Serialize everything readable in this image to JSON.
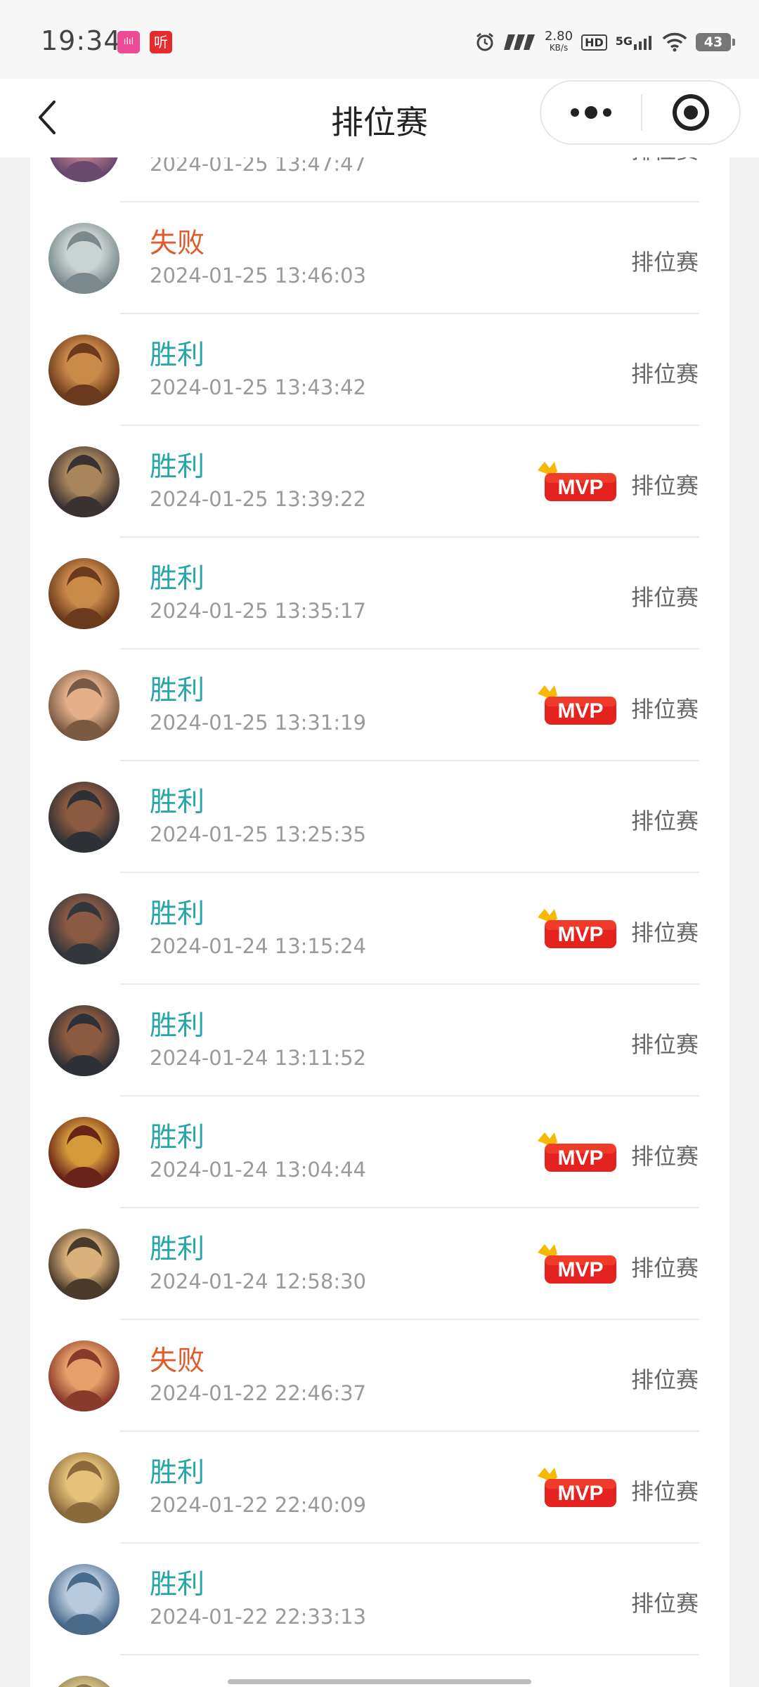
{
  "status_bar": {
    "time": "19:34",
    "app_icon_1": "bilibili-icon",
    "app_icon_2_label": "听",
    "speed_value": "2.80",
    "speed_unit": "KB/s",
    "hd_label": "HD",
    "network_label": "5G",
    "battery_level": "43"
  },
  "nav": {
    "title": "排位赛",
    "back_icon": "back-chevron-icon",
    "more_icon": "more-dots-icon",
    "close_icon": "capsule-close-icon"
  },
  "colors": {
    "win": "#26a6a6",
    "lose": "#e05a2b",
    "mvp_red": "#e4221f",
    "crown": "#f6b800"
  },
  "matches": [
    {
      "result": "",
      "time": "2024-01-25 13:47:47",
      "mvp": false,
      "mode": "排位赛",
      "outcome": "unknown"
    },
    {
      "result": "失败",
      "time": "2024-01-25 13:46:03",
      "mvp": false,
      "mode": "排位赛",
      "outcome": "lose"
    },
    {
      "result": "胜利",
      "time": "2024-01-25 13:43:42",
      "mvp": false,
      "mode": "排位赛",
      "outcome": "win"
    },
    {
      "result": "胜利",
      "time": "2024-01-25 13:39:22",
      "mvp": true,
      "mode": "排位赛",
      "outcome": "win"
    },
    {
      "result": "胜利",
      "time": "2024-01-25 13:35:17",
      "mvp": false,
      "mode": "排位赛",
      "outcome": "win"
    },
    {
      "result": "胜利",
      "time": "2024-01-25 13:31:19",
      "mvp": true,
      "mode": "排位赛",
      "outcome": "win"
    },
    {
      "result": "胜利",
      "time": "2024-01-25 13:25:35",
      "mvp": false,
      "mode": "排位赛",
      "outcome": "win"
    },
    {
      "result": "胜利",
      "time": "2024-01-24 13:15:24",
      "mvp": true,
      "mode": "排位赛",
      "outcome": "win"
    },
    {
      "result": "胜利",
      "time": "2024-01-24 13:11:52",
      "mvp": false,
      "mode": "排位赛",
      "outcome": "win"
    },
    {
      "result": "胜利",
      "time": "2024-01-24 13:04:44",
      "mvp": true,
      "mode": "排位赛",
      "outcome": "win"
    },
    {
      "result": "胜利",
      "time": "2024-01-24 12:58:30",
      "mvp": true,
      "mode": "排位赛",
      "outcome": "win"
    },
    {
      "result": "失败",
      "time": "2024-01-22 22:46:37",
      "mvp": false,
      "mode": "排位赛",
      "outcome": "lose"
    },
    {
      "result": "胜利",
      "time": "2024-01-22 22:40:09",
      "mvp": true,
      "mode": "排位赛",
      "outcome": "win"
    },
    {
      "result": "胜利",
      "time": "2024-01-22 22:33:13",
      "mvp": false,
      "mode": "排位赛",
      "outcome": "win"
    },
    {
      "result": "",
      "time": "",
      "mvp": false,
      "mode": "",
      "outcome": "unknown"
    }
  ],
  "mvp_badge_label": "MVP"
}
